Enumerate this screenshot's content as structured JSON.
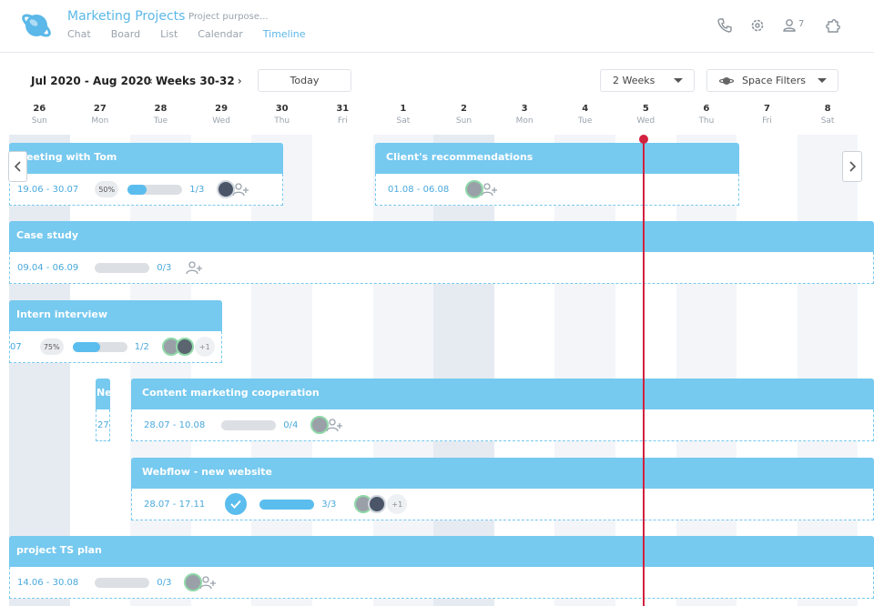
{
  "header": {
    "title": "Marketing Projects",
    "purpose_placeholder": "Project purpose...",
    "tabs": [
      {
        "label": "Chat",
        "active": false
      },
      {
        "label": "Board",
        "active": false
      },
      {
        "label": "List",
        "active": false
      },
      {
        "label": "Calendar",
        "active": false
      },
      {
        "label": "Timeline",
        "active": true
      }
    ],
    "member_count": "7"
  },
  "toolbar": {
    "range": "Jul 2020 - Aug 2020",
    "weeks": "Weeks 30-32",
    "today_label": "Today",
    "period_select": "2 Weeks",
    "filters_label": "Space Filters"
  },
  "days": [
    {
      "num": "26",
      "dow": "Sun"
    },
    {
      "num": "27",
      "dow": "Mon"
    },
    {
      "num": "28",
      "dow": "Tue"
    },
    {
      "num": "29",
      "dow": "Wed"
    },
    {
      "num": "30",
      "dow": "Thu"
    },
    {
      "num": "31",
      "dow": "Fri"
    },
    {
      "num": "1",
      "dow": "Sat"
    },
    {
      "num": "2",
      "dow": "Sun"
    },
    {
      "num": "3",
      "dow": "Mon"
    },
    {
      "num": "4",
      "dow": "Tue"
    },
    {
      "num": "5",
      "dow": "Wed"
    },
    {
      "num": "6",
      "dow": "Thu"
    },
    {
      "num": "7",
      "dow": "Fri"
    },
    {
      "num": "8",
      "dow": "Sat"
    }
  ],
  "tasks": {
    "meeting": {
      "title": "Meeting with Tom",
      "dates": "19.06 - 30.07",
      "percent": "50%",
      "progress": 0.35,
      "count": "1/3"
    },
    "client": {
      "title": "Client's recommendations",
      "dates": "01.08 - 06.08"
    },
    "case": {
      "title": "Case study",
      "dates": "09.04 - 06.09",
      "progress": 0,
      "count": "0/3"
    },
    "intern": {
      "title": "Intern interview",
      "dates": "07",
      "percent": "75%",
      "progress": 0.5,
      "count": "1/2",
      "more": "+1"
    },
    "new_small": {
      "title": "New",
      "dates": "27"
    },
    "content": {
      "title": "Content marketing cooperation",
      "dates": "28.07 - 10.08",
      "progress": 0,
      "count": "0/4"
    },
    "webflow": {
      "title": "Webflow - new website",
      "dates": "28.07 - 17.11",
      "progress": 1,
      "count": "3/3",
      "more": "+1"
    },
    "ts_plan": {
      "title": "project TS plan",
      "dates": "14.06 - 30.08",
      "progress": 0,
      "count": "0/3"
    }
  },
  "colors": {
    "accent": "#5bb8e8",
    "bar": "#76c9ef",
    "today_line": "#d1223f"
  }
}
